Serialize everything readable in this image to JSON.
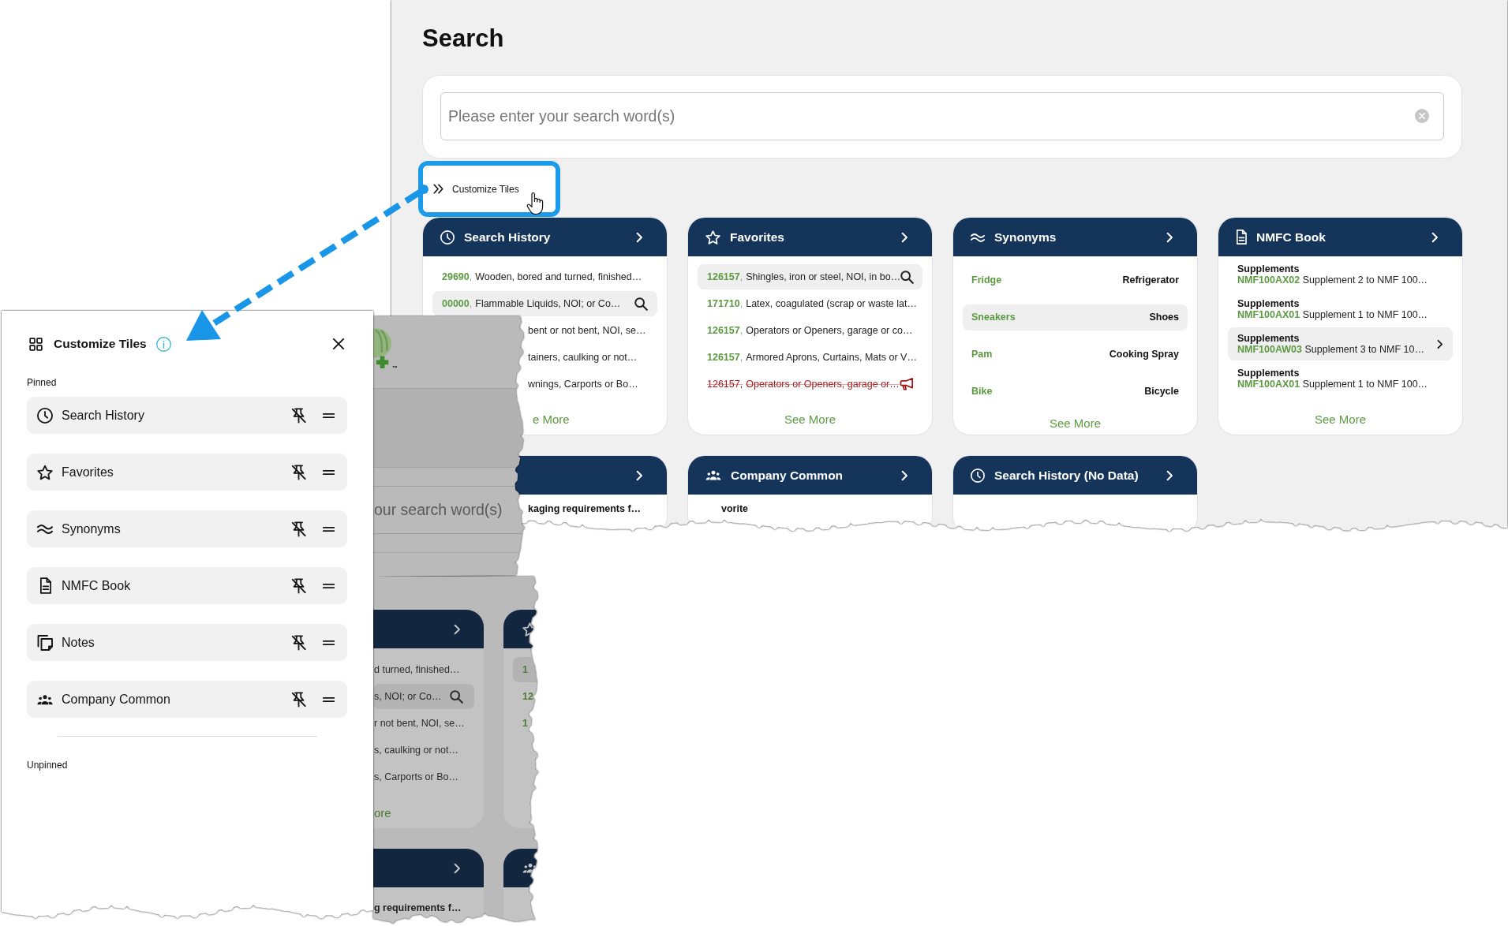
{
  "main_page": {
    "title": "Search",
    "search": {
      "placeholder": "Please enter your search word(s)"
    },
    "customize_button": {
      "label": "Customize Tiles"
    },
    "tiles": [
      {
        "kind": "search_history",
        "title": "Search History",
        "rows": [
          {
            "code": "29690",
            "sep": ",",
            "text": "Wooden, bored and turned, finished…",
            "selected": false
          },
          {
            "code": "00000",
            "sep": ",",
            "text": "Flammable Liquids, NOI; or Co…",
            "selected": true
          },
          {
            "text": "bent or not bent, NOI, se…",
            "selected": false
          },
          {
            "text": "tainers, caulking or not…",
            "selected": false
          },
          {
            "text": "wnings, Carports or Bo…",
            "selected": false
          }
        ],
        "see_more": "e More"
      },
      {
        "kind": "favorites",
        "title": "Favorites",
        "rows": [
          {
            "code": "126157",
            "sep": ",",
            "text": "Shingles, iron or steel, NOI, in bo…",
            "selected": true,
            "struck": false
          },
          {
            "code": "171710",
            "sep": ",",
            "text": "Latex, coagulated (scrap or waste lat…",
            "selected": false,
            "struck": false
          },
          {
            "code": "126157",
            "sep": ",",
            "text": "Operators or Openers, garage or co…",
            "selected": false,
            "struck": false
          },
          {
            "code": "126157",
            "sep": ",",
            "text": "Armored Aprons, Curtains, Mats or V…",
            "selected": false,
            "struck": false
          },
          {
            "code": "126157",
            "sep": ",",
            "text": "Operators or Openers, garage or…",
            "selected": false,
            "struck": true
          }
        ],
        "see_more": "See More"
      },
      {
        "kind": "synonyms",
        "title": "Synonyms",
        "rows": [
          {
            "term": "Fridge",
            "synonym": "Refrigerator",
            "selected": false
          },
          {
            "term": "Sneakers",
            "synonym": "Shoes",
            "selected": true
          },
          {
            "term": "Pam",
            "synonym": "Cooking Spray",
            "selected": false
          },
          {
            "term": "Bike",
            "synonym": "Bicycle",
            "selected": false
          }
        ],
        "see_more": "See More"
      },
      {
        "kind": "nmfc_book",
        "title": "NMFC Book",
        "rows": [
          {
            "category": "Supplements",
            "code": "NMF100AX02",
            "text": "Supplement 2 to NMF 100…",
            "selected": false
          },
          {
            "category": "Supplements",
            "code": "NMF100AX01",
            "text": "Supplement 1 to NMF 100…",
            "selected": false
          },
          {
            "category": "Supplements",
            "code": "NMF100AW03",
            "text": "Supplement 3 to NMF 10…",
            "selected": true
          },
          {
            "category": "Supplements",
            "code": "NMF100AX01",
            "text": "Supplement 1 to NMF 100…",
            "selected": false
          }
        ],
        "see_more": "See More"
      }
    ],
    "tiles_row_2": [
      {
        "kind": "notes",
        "rows": [
          {
            "text": "kaging requirements f…",
            "selected": false
          }
        ]
      },
      {
        "kind": "company_common",
        "title": "Company Common",
        "rows": [
          {
            "text": "vorite",
            "selected": false
          }
        ]
      },
      {
        "kind": "search_history",
        "title": "Search History (No Data)"
      }
    ]
  },
  "dimmed_page": {
    "logo_mark": "™",
    "search": {
      "placeholder": "our search word(s)"
    },
    "tiles": [
      {
        "kind": "search_history",
        "rows": [
          {
            "text": "d turned, finished…",
            "selected": false
          },
          {
            "text": "s, NOI; or Co…",
            "selected": true
          },
          {
            "text": "r not bent, NOI, se…",
            "selected": false
          },
          {
            "text": "s, caulking or not…",
            "selected": false
          },
          {
            "text": "s, Carports or Bo…",
            "selected": false
          }
        ],
        "see_more": "ore"
      },
      {
        "kind": "favorites",
        "rows": [
          {
            "code": "1",
            "selected": true
          },
          {
            "code": "12",
            "selected": false
          },
          {
            "code": "1",
            "selected": false
          }
        ]
      }
    ],
    "tiles_row_2": [
      {
        "kind": "notes",
        "rows": [
          {
            "text": "g requirements f…",
            "selected": false
          }
        ]
      },
      {
        "kind": "company_common"
      }
    ]
  },
  "customize_panel": {
    "title": "Customize Tiles",
    "pinned_label": "Pinned",
    "pinned": [
      {
        "kind": "search_history",
        "label": "Search History"
      },
      {
        "kind": "favorites",
        "label": "Favorites"
      },
      {
        "kind": "synonyms",
        "label": "Synonyms"
      },
      {
        "kind": "nmfc_book",
        "label": "NMFC Book"
      },
      {
        "kind": "notes",
        "label": "Notes"
      },
      {
        "kind": "company_common",
        "label": "Company Common"
      }
    ],
    "unpinned_label": "Unpinned"
  }
}
